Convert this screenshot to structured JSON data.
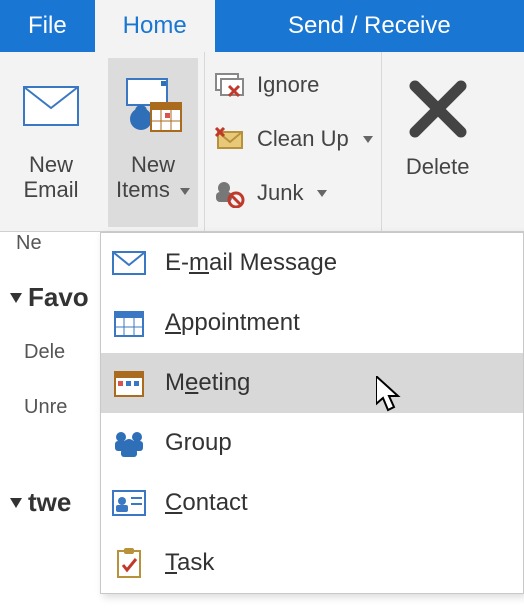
{
  "tabs": {
    "file": "File",
    "home": "Home",
    "sendreceive": "Send / Receive"
  },
  "ribbon": {
    "new_email_l1": "New",
    "new_email_l2": "Email",
    "new_items_l1": "New",
    "new_items_l2": "Items",
    "ignore": "Ignore",
    "cleanup": "Clean Up",
    "junk": "Junk",
    "delete": "Delete"
  },
  "hint": "Ne",
  "left": {
    "fav": "Favo",
    "dele": "Dele",
    "unre": "Unre",
    "twe": "twe"
  },
  "dropdown": {
    "email_pre": "E-",
    "email_u": "m",
    "email_post": "ail Message",
    "appt_u": "A",
    "appt_post": "ppointment",
    "meet_pre": "M",
    "meet_u": "e",
    "meet_post": "eting",
    "group": "Group",
    "contact_u": "C",
    "contact_post": "ontact",
    "task_u": "T",
    "task_post": "ask"
  }
}
